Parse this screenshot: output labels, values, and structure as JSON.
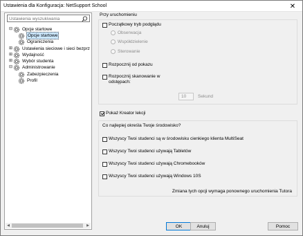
{
  "window": {
    "title": "Ustawienia dla Konfiguracja: NetSupport School",
    "close_glyph": "✕"
  },
  "sidebar": {
    "search_placeholder": "Ustawienia wyszukiwania",
    "tree": [
      {
        "label": "Opcje startowe",
        "level": 0,
        "expanded": true,
        "selected": false
      },
      {
        "label": "Opcje startowe",
        "level": 1,
        "expanded": null,
        "selected": true
      },
      {
        "label": "Ograniczenia",
        "level": 1,
        "expanded": null,
        "selected": false
      },
      {
        "label": "Ustawienia sieciowe i sieci bezprz",
        "level": 0,
        "expanded": false,
        "selected": false
      },
      {
        "label": "Wydajność",
        "level": 0,
        "expanded": false,
        "selected": false
      },
      {
        "label": "Wybór studenta",
        "level": 0,
        "expanded": false,
        "selected": false
      },
      {
        "label": "Administrowanie",
        "level": 0,
        "expanded": true,
        "selected": false
      },
      {
        "label": "Zabezpieczenia",
        "level": 1,
        "expanded": null,
        "selected": false
      },
      {
        "label": "Profil",
        "level": 1,
        "expanded": null,
        "selected": false
      }
    ]
  },
  "startup": {
    "section_label": "Przy uruchomieniu",
    "initial_view_label": "Początkowy tryb podglądu",
    "initial_view_checked": false,
    "radios": [
      "Obserwacja",
      "Współdzielenie",
      "Sterowanie"
    ],
    "start_show_label": "Rozpocznij od pokazu",
    "start_show_checked": false,
    "scan_label_line1": "Rozpocznij skanowanie w",
    "scan_label_line2": "odstępach:",
    "scan_checked": false,
    "scan_value": "10",
    "scan_unit": "Sekund"
  },
  "wizard": {
    "label": "Pokaż Kreator lekcji",
    "checked": true
  },
  "environment": {
    "section_label": "Co najlepiej określa Twoje środowisko?",
    "options": [
      {
        "label": "Wszyscy Twoi studenci są w środowisku cienkiego klienta MultiSeat",
        "checked": false
      },
      {
        "label": "Wszyscy Twoi studenci używają Tabletów",
        "checked": false
      },
      {
        "label": "Wszyscy Twoi studenci używają Chromebooków",
        "checked": false
      },
      {
        "label": "Wszyscy Twoi studenci używają Windows 10S",
        "checked": false
      }
    ],
    "note": "Zmiana tych opcji wymaga ponownego uruchomienia Tutora"
  },
  "buttons": {
    "ok": "OK",
    "cancel": "Anuluj",
    "help": "Pomoc"
  },
  "icons": {
    "search": "search-icon",
    "gear": "gear-icon",
    "expand": "minus-expander-icon",
    "collapse": "plus-expander-icon",
    "close": "close-icon"
  }
}
